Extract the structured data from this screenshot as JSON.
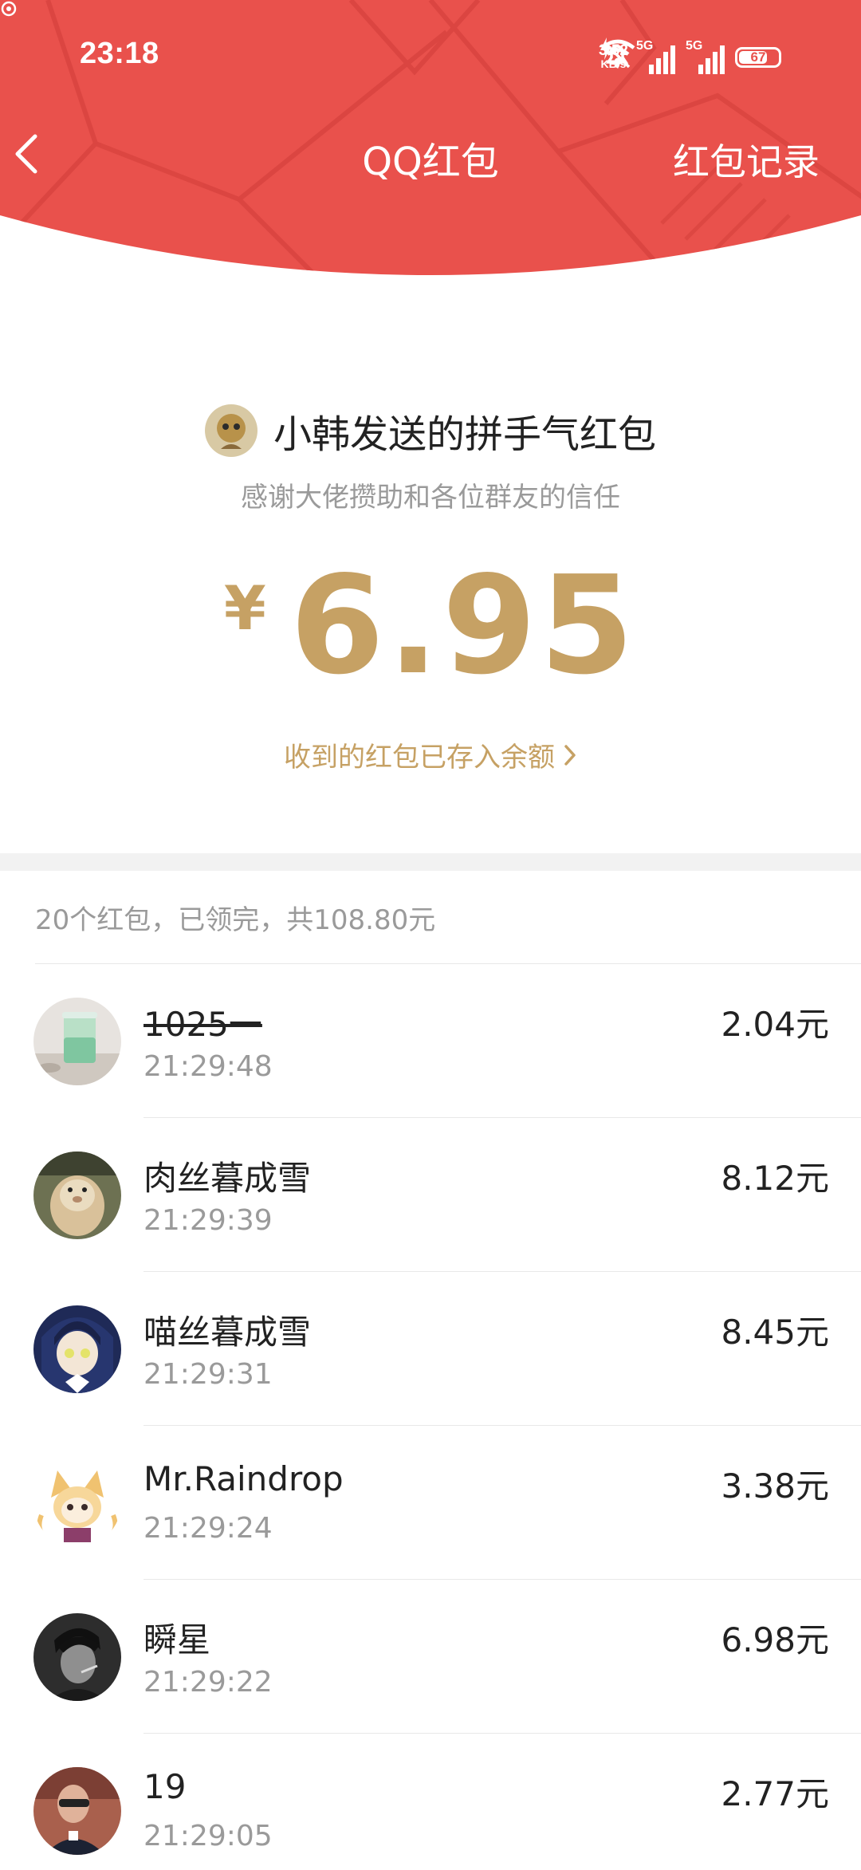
{
  "status_bar": {
    "time": "23:18",
    "net_speed_value": "3.52",
    "net_speed_unit": "KB/s",
    "sim1_tag": "5G",
    "sim2_tag": "5G",
    "battery": "67"
  },
  "nav": {
    "title": "QQ红包",
    "record_label": "红包记录"
  },
  "colors": {
    "header_red": "#e9514c",
    "gold": "#c6a164"
  },
  "packet": {
    "sender_title": "小韩发送的拼手气红包",
    "blessing": "感谢大佬攒助和各位群友的信任",
    "currency": "¥",
    "amount": "6.95",
    "balance_link": "收到的红包已存入余额"
  },
  "summary": "20个红包，已领完，共108.80元",
  "list": [
    {
      "name": "1025一",
      "time": "21:29:48",
      "amount": "2.04元",
      "avatar_icon": "drink-photo-avatar"
    },
    {
      "name": "肉丝暮成雪",
      "time": "21:29:39",
      "amount": "8.12元",
      "avatar_icon": "hamster-avatar"
    },
    {
      "name": "喵丝暮成雪",
      "time": "21:29:31",
      "amount": "8.45元",
      "avatar_icon": "anime-girl-avatar"
    },
    {
      "name": "Mr.Raindrop",
      "time": "21:29:24",
      "amount": "3.38元",
      "avatar_icon": "fox-girl-avatar"
    },
    {
      "name": "瞬星",
      "time": "21:29:22",
      "amount": "6.98元",
      "avatar_icon": "dark-portrait-avatar"
    },
    {
      "name": "19",
      "time": "21:29:05",
      "amount": "2.77元",
      "avatar_icon": "person-photo-avatar"
    }
  ]
}
